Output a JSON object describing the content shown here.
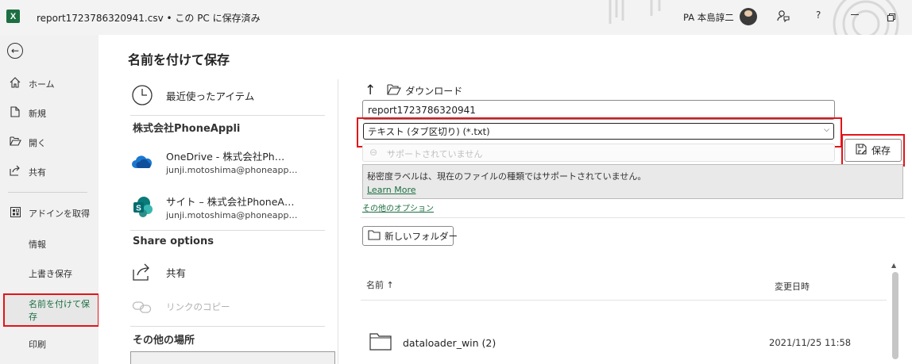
{
  "titlebar": {
    "app_logo": "X",
    "title": "report1723786320941.csv • この PC に保存済み",
    "user": "PA 本島諄二",
    "icons": [
      "feedback-icon",
      "help-icon",
      "minimize-icon",
      "restore-icon"
    ],
    "help": "?"
  },
  "nav": {
    "back": "←",
    "items": [
      {
        "icon": "home-icon",
        "label": "ホーム"
      },
      {
        "icon": "new-icon",
        "label": "新規"
      },
      {
        "icon": "open-icon",
        "label": "開く"
      },
      {
        "icon": "share-icon",
        "label": "共有"
      },
      {
        "icon": "addins-icon",
        "label": "アドインを取得"
      }
    ],
    "info": "情報",
    "save": "上書き保存",
    "save_as": "名前を付けて保存",
    "print": "印刷"
  },
  "main": {
    "title": "名前を付けて保存",
    "recent": "最近使ったアイテム",
    "org_header": "株式会社PhoneAppli",
    "onedrive": {
      "name": "OneDrive - 株式会社Ph…",
      "email": "junji.motoshima@phoneapp…"
    },
    "sites": {
      "name": "サイト – 株式会社PhoneA…",
      "email": "junji.motoshima@phoneapp…"
    },
    "share_header": "Share options",
    "share": "共有",
    "copy_link": "リンクのコピー",
    "other_header": "その他の場所"
  },
  "right": {
    "up_arrow": "↑",
    "path": "ダウンロード",
    "filename": "report1723786320941",
    "filetype": "テキスト (タブ区切り) (*.txt)",
    "sensitivity_placeholder": "サポートされていません",
    "save_button": "保存",
    "notice": "秘密度ラベルは、現在のファイルの種類ではサポートされていません。",
    "learn_more": "Learn More",
    "more_options": "その他のオプション",
    "new_folder": "新しいフォルダー",
    "col_name": "名前 ↑",
    "col_date": "変更日時",
    "files": [
      {
        "name": "dataloader_win (2)",
        "date": "2021/11/25 11:58"
      }
    ]
  },
  "colors": {
    "excel_green": "#1d6f42",
    "highlight_red": "#e3141a"
  }
}
